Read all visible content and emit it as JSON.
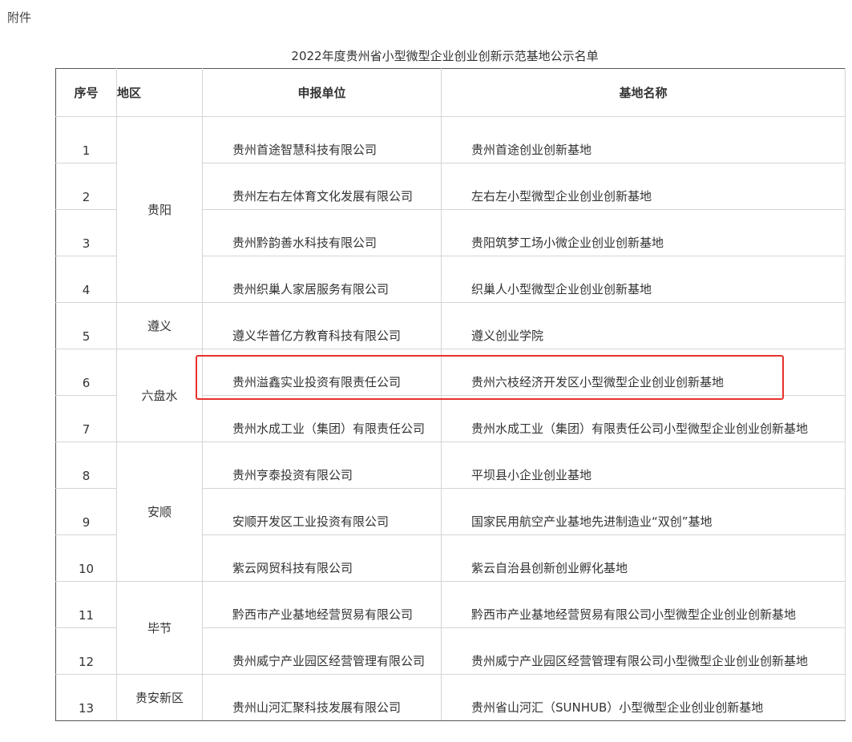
{
  "attachment_label": "附件",
  "title": "2022年度贵州省小型微型企业创业创新示范基地公示名单",
  "headers": {
    "seq": "序号",
    "region": "地区",
    "unit": "申报单位",
    "base": "基地名称"
  },
  "rows": [
    {
      "seq": "1",
      "unit": "贵州首途智慧科技有限公司",
      "base": "贵州首途创业创新基地"
    },
    {
      "seq": "2",
      "unit": "贵州左右左体育文化发展有限公司",
      "base": "左右左小型微型企业创业创新基地"
    },
    {
      "seq": "3",
      "unit": "贵州黔韵善水科技有限公司",
      "base": "贵阳筑梦工场小微企业创业创新基地"
    },
    {
      "seq": "4",
      "unit": "贵州织巢人家居服务有限公司",
      "base": "织巢人小型微型企业创业创新基地"
    },
    {
      "seq": "5",
      "unit": "遵义华普亿方教育科技有限公司",
      "base": "遵义创业学院"
    },
    {
      "seq": "6",
      "unit": "贵州溢鑫实业投资有限责任公司",
      "base": "贵州六枝经济开发区小型微型企业创业创新基地"
    },
    {
      "seq": "7",
      "unit": "贵州水成工业（集团）有限责任公司",
      "base": "贵州水成工业（集团）有限责任公司小型微型企业创业创新基地"
    },
    {
      "seq": "8",
      "unit": "贵州亨泰投资有限公司",
      "base": "平坝县小企业创业基地"
    },
    {
      "seq": "9",
      "unit": "安顺开发区工业投资有限公司",
      "base": "国家民用航空产业基地先进制造业“双创”基地"
    },
    {
      "seq": "10",
      "unit": "紫云网贸科技有限公司",
      "base": "紫云自治县创新创业孵化基地"
    },
    {
      "seq": "11",
      "unit": "黔西市产业基地经营贸易有限公司",
      "base": "黔西市产业基地经营贸易有限公司小型微型企业创业创新基地"
    },
    {
      "seq": "12",
      "unit": "贵州威宁产业园区经营管理有限公司",
      "base": "贵州威宁产业园区经营管理有限公司小型微型企业创业创新基地"
    },
    {
      "seq": "13",
      "unit": "贵州山河汇聚科技发展有限公司",
      "base": "贵州省山河汇（SUNHUB）小型微型企业创业创新基地"
    }
  ],
  "regions": {
    "guiyang": "贵阳",
    "zunyi": "遵义",
    "liupanshui": "六盘水",
    "anshun": "安顺",
    "bijie": "毕节",
    "guian": "贵安新区"
  },
  "highlight_color": "#e8322c"
}
